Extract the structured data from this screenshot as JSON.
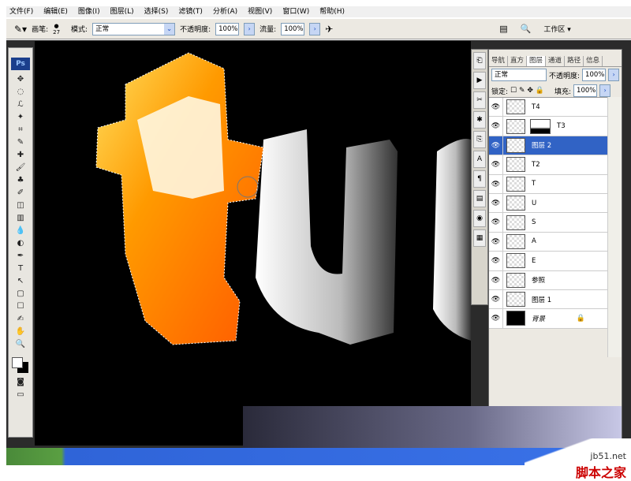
{
  "menu": [
    "文件(F)",
    "编辑(E)",
    "图像(I)",
    "图层(L)",
    "选择(S)",
    "滤镜(T)",
    "分析(A)",
    "视图(V)",
    "窗口(W)",
    "帮助(H)"
  ],
  "options": {
    "brush_label": "画笔:",
    "brush_size": "27",
    "mode_label": "模式:",
    "mode_value": "正常",
    "opacity_label": "不透明度:",
    "opacity_value": "100%",
    "flow_label": "流量:",
    "flow_value": "100%",
    "workspace": "工作区 ▾"
  },
  "toolbar": {
    "logo": "Ps",
    "tools": [
      "✥",
      "◌",
      "ℒ",
      "✦",
      "⌗",
      "✎",
      "✚",
      "🖌",
      "♣",
      "✐",
      "◫",
      "▥",
      "💧",
      "◐",
      "✒",
      "T",
      "↖",
      "▢",
      "☐",
      "✍",
      "✋",
      "🔍"
    ]
  },
  "panel": {
    "tabs": [
      "导航",
      "直方",
      "图层",
      "通道",
      "路径",
      "信息"
    ],
    "active_tab": "图层",
    "blend_mode": "正常",
    "opacity_label": "不透明度:",
    "opacity_value": "100%",
    "lock_label": "锁定:",
    "fill_label": "填充:",
    "fill_value": "100%",
    "layers": [
      {
        "name": "T4"
      },
      {
        "name": "T3",
        "mask": true
      },
      {
        "name": "图层 2",
        "selected": true
      },
      {
        "name": "T2"
      },
      {
        "name": "T"
      },
      {
        "name": "U"
      },
      {
        "name": "S"
      },
      {
        "name": "A"
      },
      {
        "name": "E"
      },
      {
        "name": "参照"
      },
      {
        "name": "图层 1"
      },
      {
        "name": "背景",
        "background": true,
        "locked": true
      }
    ]
  },
  "watermark": {
    "url": "jb51.net",
    "name": "脚本之家"
  },
  "colors": {
    "selection": "#3163c5",
    "orange": "#ff7a00"
  }
}
